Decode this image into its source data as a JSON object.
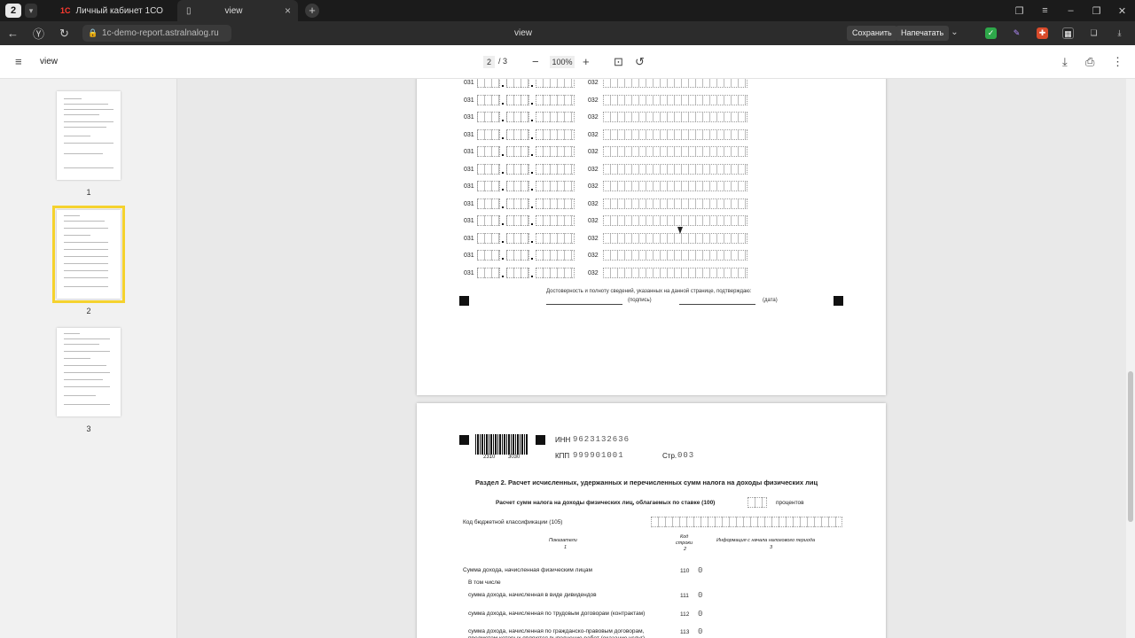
{
  "tabs": {
    "count": "2",
    "tab1_logo": "1С",
    "tab1_label": "Личный кабинет 1СО",
    "tab2_label": "view"
  },
  "address": {
    "url": "1c-demo-report.astralnalog.ru",
    "page_title": "view",
    "save_label": "Сохранить",
    "print_label": "Напечатать"
  },
  "pdf": {
    "title": "view",
    "current_page": "2",
    "total_pages": "/ 3",
    "zoom": "100%"
  },
  "thumbnails": [
    {
      "label": "1"
    },
    {
      "label": "2"
    },
    {
      "label": "3"
    }
  ],
  "page2": {
    "code_left": "031",
    "code_right": "032",
    "sign_text": "Достоверность и полноту сведений, указанных на данной странице, подтверждаю:",
    "sign_label": "(подпись)",
    "date_label": "(дата)"
  },
  "page3": {
    "barcode_left": "2310",
    "barcode_right": "3030",
    "inn_label": "ИНН",
    "inn_value": "9623132636",
    "kpp_label": "КПП",
    "kpp_value": "999901001",
    "page_label": "Стр.",
    "page_value": "003",
    "section_title": "Раздел 2. Расчет исчисленных, удержанных и перечисленных сумм налога на доходы физических лиц",
    "rate_text": "Расчет сумм налога на доходы физических лиц, облагаемых по ставке (100)",
    "percent_label": "процентов",
    "kbk_label": "Код бюджетной классификации  (105)",
    "col1": "Показатели",
    "col1_num": "1",
    "col2a": "Код",
    "col2b": "строки",
    "col2_num": "2",
    "col3": "Информация с начала налогового периода",
    "col3_num": "3",
    "rows": [
      {
        "label": "Сумма дохода, начисленная физическим лицам",
        "code": "110",
        "value": "0"
      },
      {
        "label": "В том числе",
        "code": "",
        "value": ""
      },
      {
        "label": "сумма дохода, начисленная в виде дивидендов",
        "code": "111",
        "value": "0"
      },
      {
        "label": "сумма дохода, начисленная по трудовым договорам (контрактам)",
        "code": "112",
        "value": "0"
      },
      {
        "label": "сумма дохода, начисленная по гражданско-правовым договорам,",
        "label2": "предметом которых являются выполнение работ (оказание услуг)",
        "code": "113",
        "value": "0"
      }
    ]
  },
  "colors": {
    "selected_thumb": "#f5d22e",
    "viewer_bg": "#e9e9e9"
  }
}
